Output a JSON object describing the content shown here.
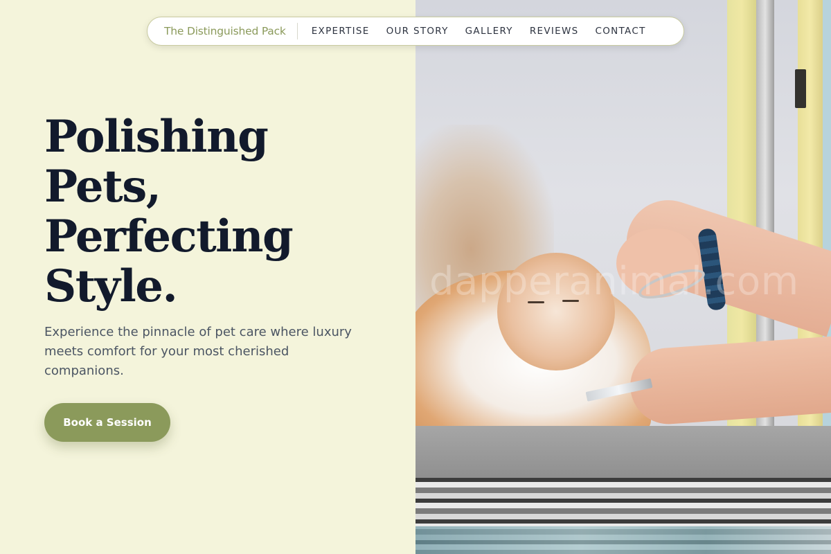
{
  "nav": {
    "brand": "The Distinguished Pack",
    "links": [
      "EXPERTISE",
      "OUR STORY",
      "GALLERY",
      "REVIEWS",
      "CONTACT"
    ]
  },
  "hero": {
    "headline_lines": [
      "Polishing",
      "Pets,",
      "Perfecting",
      "Style."
    ],
    "subtitle": "Experience the pinnacle of pet care where luxury meets comfort for your most cherished companions.",
    "cta_label": "Book a Session"
  },
  "image": {
    "subject": "groomer-trimming-persian-cat",
    "watermark": "dapperanimal.com"
  },
  "colors": {
    "background": "#f4f4db",
    "accent": "#8b9a5b",
    "headline": "#121a2c",
    "body_text": "#4b5563"
  }
}
